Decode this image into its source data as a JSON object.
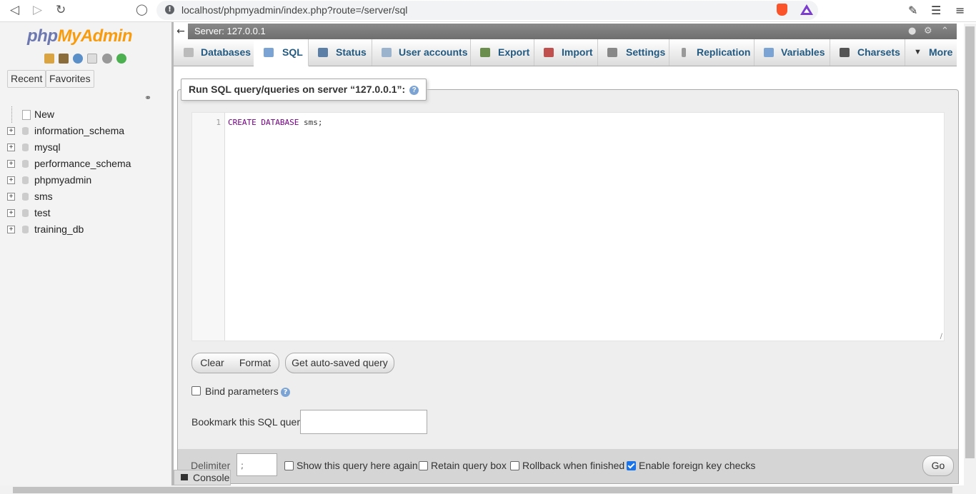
{
  "browser": {
    "url": "localhost/phpmyadmin/index.php?route=/server/sql"
  },
  "nav": {
    "logo_php": "php",
    "logo_myadmin": "MyAdmin",
    "recent": "Recent",
    "favorites": "Favorites",
    "tree": [
      {
        "label": "New",
        "type": "new"
      },
      {
        "label": "information_schema",
        "type": "db"
      },
      {
        "label": "mysql",
        "type": "db"
      },
      {
        "label": "performance_schema",
        "type": "db"
      },
      {
        "label": "phpmyadmin",
        "type": "db"
      },
      {
        "label": "sms",
        "type": "db"
      },
      {
        "label": "test",
        "type": "db"
      },
      {
        "label": "training_db",
        "type": "db"
      }
    ]
  },
  "server": {
    "title": "Server: 127.0.0.1"
  },
  "tabs": [
    {
      "label": "Databases",
      "icon": "database-icon"
    },
    {
      "label": "SQL",
      "icon": "sql-icon",
      "active": true
    },
    {
      "label": "Status",
      "icon": "status-icon"
    },
    {
      "label": "User accounts",
      "icon": "users-icon"
    },
    {
      "label": "Export",
      "icon": "export-icon"
    },
    {
      "label": "Import",
      "icon": "import-icon"
    },
    {
      "label": "Settings",
      "icon": "wrench-icon"
    },
    {
      "label": "Replication",
      "icon": "replication-icon"
    },
    {
      "label": "Variables",
      "icon": "variables-icon"
    },
    {
      "label": "Charsets",
      "icon": "charsets-icon"
    },
    {
      "label": "More",
      "icon": "caret-down-icon"
    }
  ],
  "query_panel": {
    "legend": "Run SQL query/queries on server “127.0.0.1”:",
    "line_number": "1",
    "code_kw1": "CREATE",
    "code_kw2": "DATABASE",
    "code_rest": "sms;",
    "clear": "Clear",
    "format": "Format",
    "autosaved": "Get auto-saved query",
    "bind_params": "Bind parameters",
    "bookmark_label": "Bookmark this SQL query:",
    "bookmark_value": ""
  },
  "options": {
    "delimiter_label": "Delimiter",
    "delimiter_value": ";",
    "show_query": "Show this query here again",
    "show_query_checked": false,
    "retain_box": "Retain query box",
    "retain_box_checked": false,
    "rollback": "Rollback when finished",
    "rollback_checked": false,
    "fk_checks": "Enable foreign key checks",
    "fk_checks_checked": true,
    "go": "Go"
  },
  "console": {
    "label": "Console"
  },
  "colors": {
    "tab_text": "#235a81",
    "logo_php": "#6c78af",
    "logo_myadmin": "#f89c0e",
    "sql_keyword": "#770088",
    "checkbox_on": "#1a73e8"
  }
}
